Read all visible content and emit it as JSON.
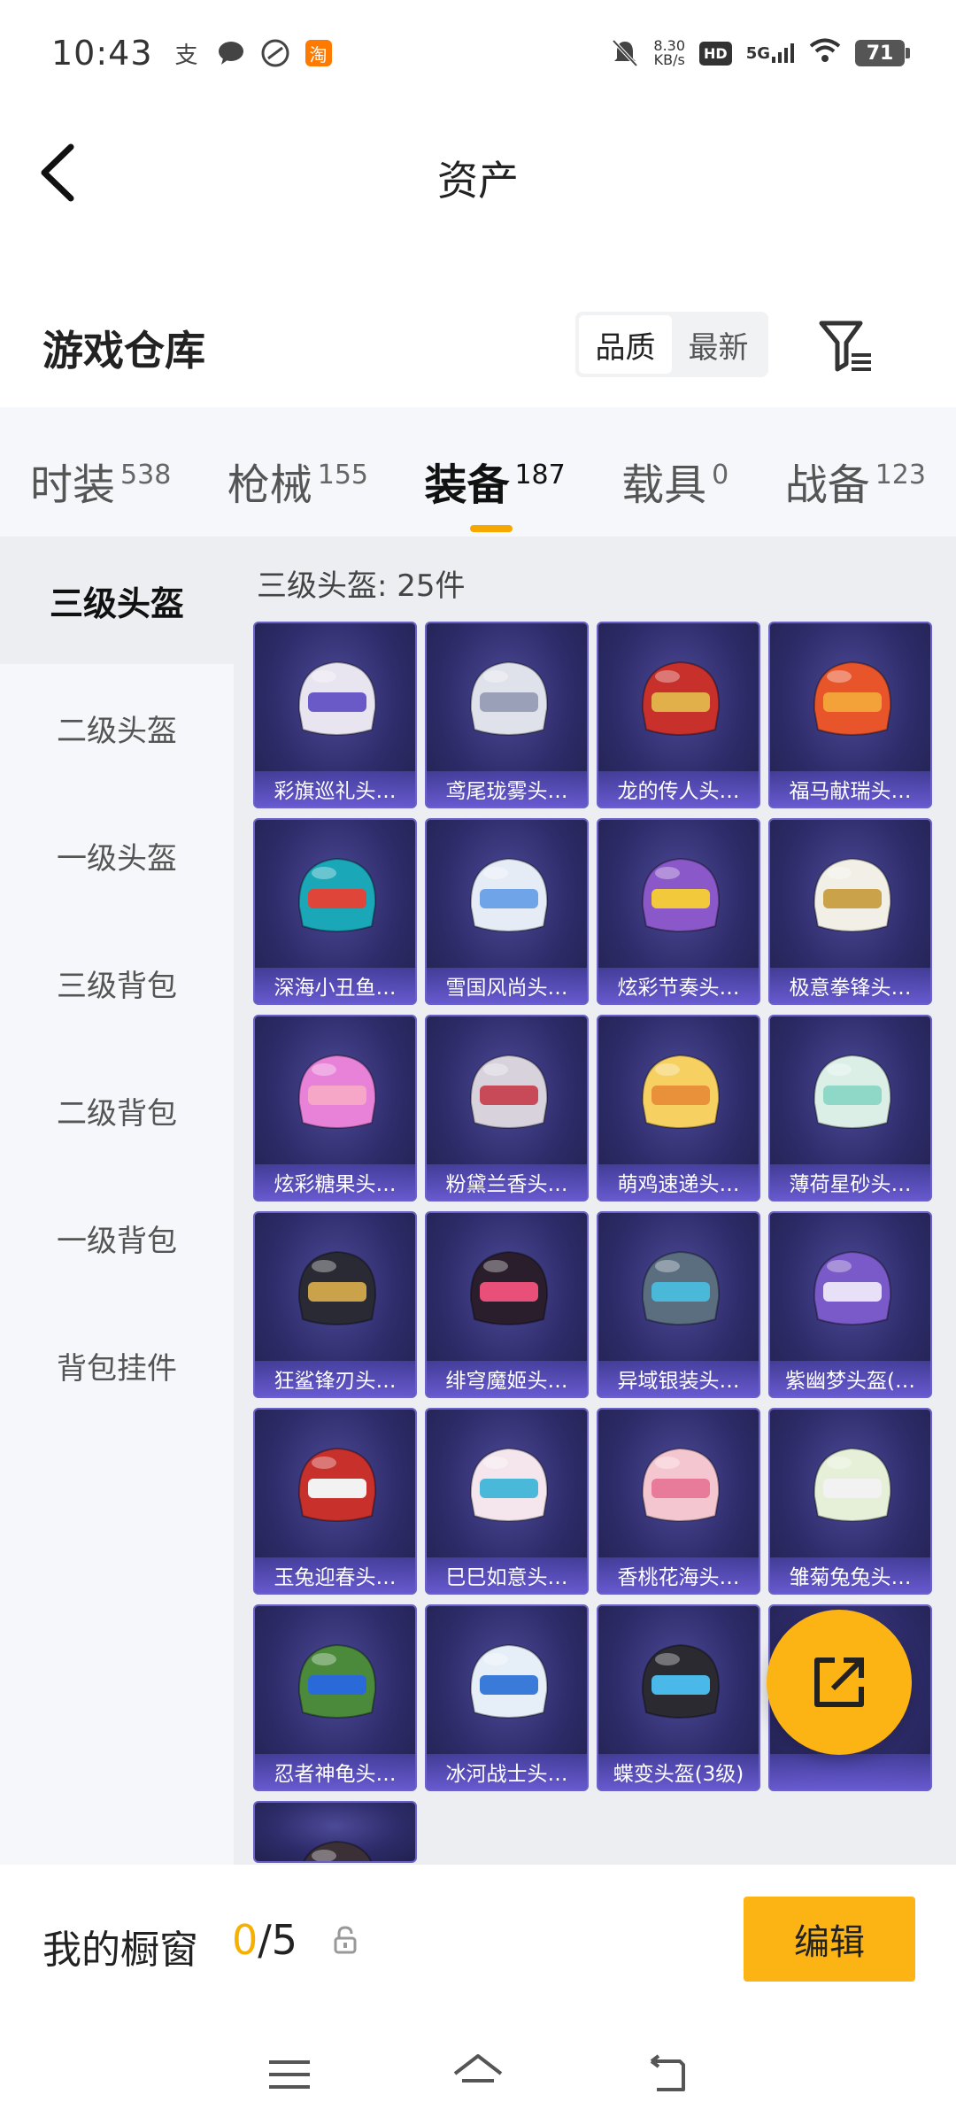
{
  "status_bar": {
    "time": "10:43",
    "left_icons": [
      "alipay-icon",
      "message-icon",
      "link-icon",
      "taobao-icon"
    ],
    "taobao_label": "淘",
    "net_speed": "8.30",
    "net_speed_unit": "KB/s",
    "hd": "HD",
    "signal": "5G",
    "battery": "71"
  },
  "header": {
    "title": "资产"
  },
  "warehouse": {
    "title": "游戏仓库",
    "sort_options": [
      "品质",
      "最新"
    ],
    "active_sort": "品质"
  },
  "tabs": [
    {
      "label": "时装",
      "count": "538"
    },
    {
      "label": "枪械",
      "count": "155"
    },
    {
      "label": "装备",
      "count": "187"
    },
    {
      "label": "载具",
      "count": "0"
    },
    {
      "label": "战备",
      "count": "123"
    }
  ],
  "active_tab": "装备",
  "side_menu": {
    "items": [
      "三级头盔",
      "二级头盔",
      "一级头盔",
      "三级背包",
      "二级背包",
      "一级背包",
      "背包挂件"
    ],
    "active": "三级头盔"
  },
  "grid": {
    "heading": "三级头盔: 25件",
    "items": [
      {
        "name": "彩旗巡礼头…",
        "color": "#e8e4f0",
        "accent": "#6a5ac8"
      },
      {
        "name": "鸢尾珑雾头…",
        "color": "#dfe2ea",
        "accent": "#9aa0b8"
      },
      {
        "name": "龙的传人头…",
        "color": "#c8302c",
        "accent": "#e2b04a"
      },
      {
        "name": "福马献瑞头…",
        "color": "#e8552a",
        "accent": "#f3a23a"
      },
      {
        "name": "深海小丑鱼…",
        "color": "#1aa8b8",
        "accent": "#e0453a"
      },
      {
        "name": "雪国风尚头…",
        "color": "#e6ecf6",
        "accent": "#6fa4e8"
      },
      {
        "name": "炫彩节奏头…",
        "color": "#8a58c8",
        "accent": "#f2c93a"
      },
      {
        "name": "极意拳锋头…",
        "color": "#f2efe6",
        "accent": "#c9a24a"
      },
      {
        "name": "炫彩糖果头…",
        "color": "#e882d8",
        "accent": "#f6a7c8"
      },
      {
        "name": "粉黛兰香头…",
        "color": "#d8d2dc",
        "accent": "#c84a58"
      },
      {
        "name": "萌鸡速递头…",
        "color": "#f6d060",
        "accent": "#e8903a"
      },
      {
        "name": "薄荷星砂头…",
        "color": "#dcefe6",
        "accent": "#8fd8c8"
      },
      {
        "name": "狂鲨锋刃头…",
        "color": "#2a2a34",
        "accent": "#c9a24a"
      },
      {
        "name": "绯穹魔姬头…",
        "color": "#2a1e2c",
        "accent": "#e8507a"
      },
      {
        "name": "异域银装头…",
        "color": "#5a6e80",
        "accent": "#4ab8d8"
      },
      {
        "name": "紫幽梦头盔(…",
        "color": "#7a5ac8",
        "accent": "#e8e0f6"
      },
      {
        "name": "玉兔迎春头…",
        "color": "#c8302c",
        "accent": "#f2f2f2"
      },
      {
        "name": "巳巳如意头…",
        "color": "#f4e6ec",
        "accent": "#4ab8d8"
      },
      {
        "name": "香桃花海头…",
        "color": "#f4c6d0",
        "accent": "#e87a9a"
      },
      {
        "name": "雏菊兔兔头…",
        "color": "#e6f0d8",
        "accent": "#f2f2f2"
      },
      {
        "name": "忍者神龟头…",
        "color": "#4a8a3a",
        "accent": "#2a6ad8"
      },
      {
        "name": "冰河战士头…",
        "color": "#e6eef8",
        "accent": "#3a7ad8"
      },
      {
        "name": "蝶变头盔(3级)",
        "color": "#2a2a30",
        "accent": "#4ab8e8"
      },
      {
        "name": "",
        "color": "#f4d870",
        "accent": "#4ab8e8"
      },
      {
        "name": "",
        "color": "#3a3036",
        "accent": "#c8302c"
      }
    ]
  },
  "fab": {
    "icon": "share-external-icon"
  },
  "showcase": {
    "label": "我的橱窗",
    "current": "0",
    "separator": "/",
    "max": "5",
    "edit_label": "编辑"
  },
  "nav": [
    "menu-icon",
    "home-icon",
    "back-icon"
  ]
}
